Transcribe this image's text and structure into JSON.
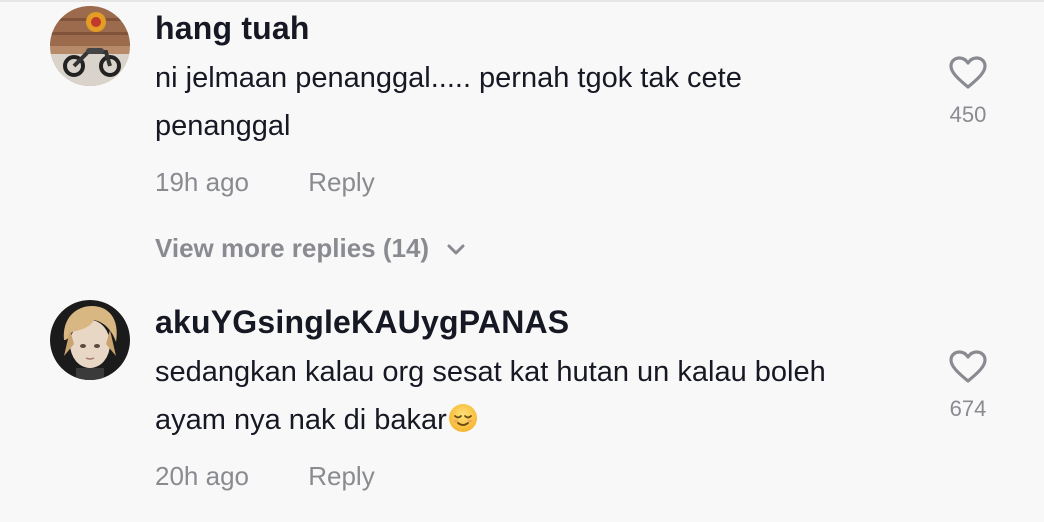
{
  "comments": [
    {
      "username": "hang tuah",
      "text": "ni jelmaan penanggal..... pernah tgok tak cete penanggal",
      "time": "19h ago",
      "reply_label": "Reply",
      "likes": "450",
      "avatar": "motorcycle-avatar"
    },
    {
      "username": "akuYGsingleKAUygPANAS",
      "text": "sedangkan kalau org sesat kat hutan un kalau boleh ayam nya nak di bakar",
      "emoji": "relieved-face-emoji",
      "time": "20h ago",
      "reply_label": "Reply",
      "likes": "674",
      "avatar": "anime-character-avatar"
    }
  ],
  "view_more_replies": "View more replies (14)",
  "colors": {
    "background": "#f8f8f8",
    "primary_text": "#161823",
    "secondary_text": "#8a8b91"
  },
  "icons": {
    "like": "heart-outline-icon",
    "expand": "chevron-down-icon"
  }
}
